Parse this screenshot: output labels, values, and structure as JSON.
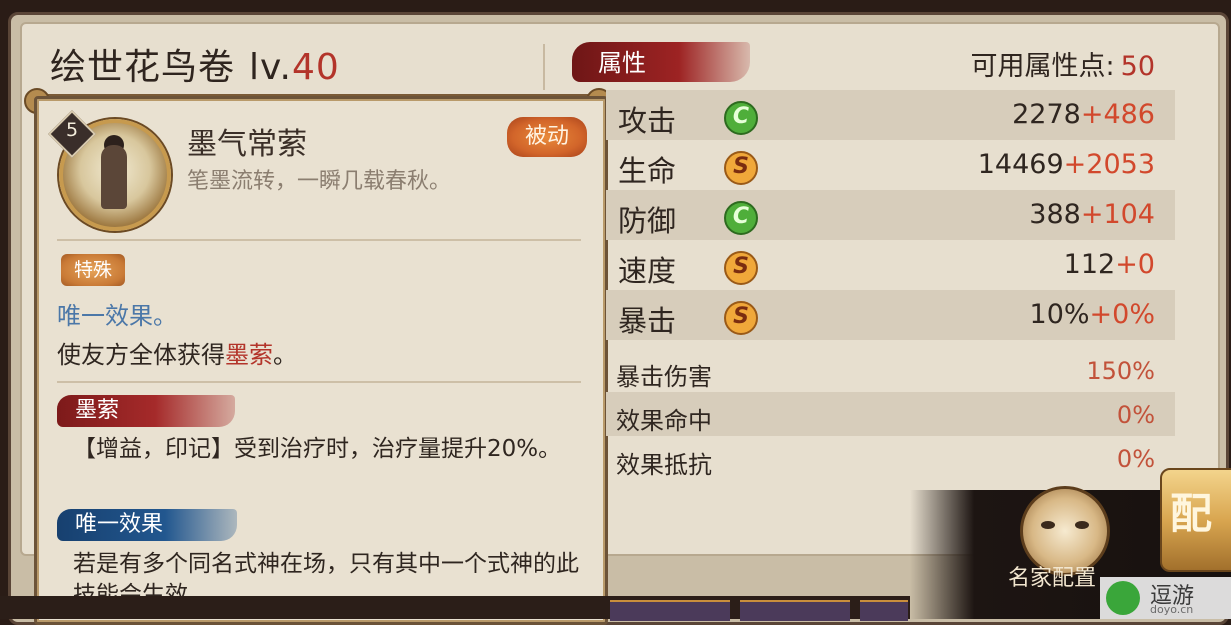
{
  "header": {
    "title": "绘世花鸟卷",
    "level_prefix": "lv.",
    "level_value": "40"
  },
  "skill": {
    "level": "5",
    "name": "墨气常萦",
    "description": "笔墨流转，一瞬几载春秋。",
    "type_badge": "被动",
    "special_tag": "特殊",
    "effect_title": "唯一效果。",
    "effect_text_prefix": "使友方全体获得",
    "effect_text_highlight": "墨萦",
    "effect_text_suffix": "。",
    "buff1_name": "墨萦",
    "buff1_text": "【增益，印记】受到治疗时，治疗量提升20%。",
    "buff2_name": "唯一效果",
    "buff2_text": "若是有多个同名式神在场，只有其中一个式神的此技能会生效。"
  },
  "attributes": {
    "section_label": "属性",
    "points_label": "可用属性点:",
    "points_value": "50",
    "stats": [
      {
        "label": "攻击",
        "grade": "C",
        "grade_color": "green",
        "base": "2278",
        "bonus": "+486"
      },
      {
        "label": "生命",
        "grade": "S",
        "grade_color": "orange",
        "base": "14469",
        "bonus": "+2053"
      },
      {
        "label": "防御",
        "grade": "C",
        "grade_color": "green",
        "base": "388",
        "bonus": "+104"
      },
      {
        "label": "速度",
        "grade": "S",
        "grade_color": "orange",
        "base": "112",
        "bonus": "+0"
      },
      {
        "label": "暴击",
        "grade": "S",
        "grade_color": "orange",
        "base": "10%",
        "bonus": "+0%"
      }
    ],
    "sub_stats": [
      {
        "label": "暴击伤害",
        "value": "150%"
      },
      {
        "label": "效果命中",
        "value": "0%"
      },
      {
        "label": "效果抵抗",
        "value": "0%"
      }
    ]
  },
  "bottom": {
    "master_config_label": "名家配置",
    "config_button_label": "配"
  },
  "watermark": {
    "text": "逗游",
    "sub": "doyo.cn"
  },
  "colors": {
    "accent_red": "#b3342a",
    "bonus_orange": "#d2482c",
    "grade_green": "#4fae3a",
    "grade_orange": "#f0a83a"
  }
}
